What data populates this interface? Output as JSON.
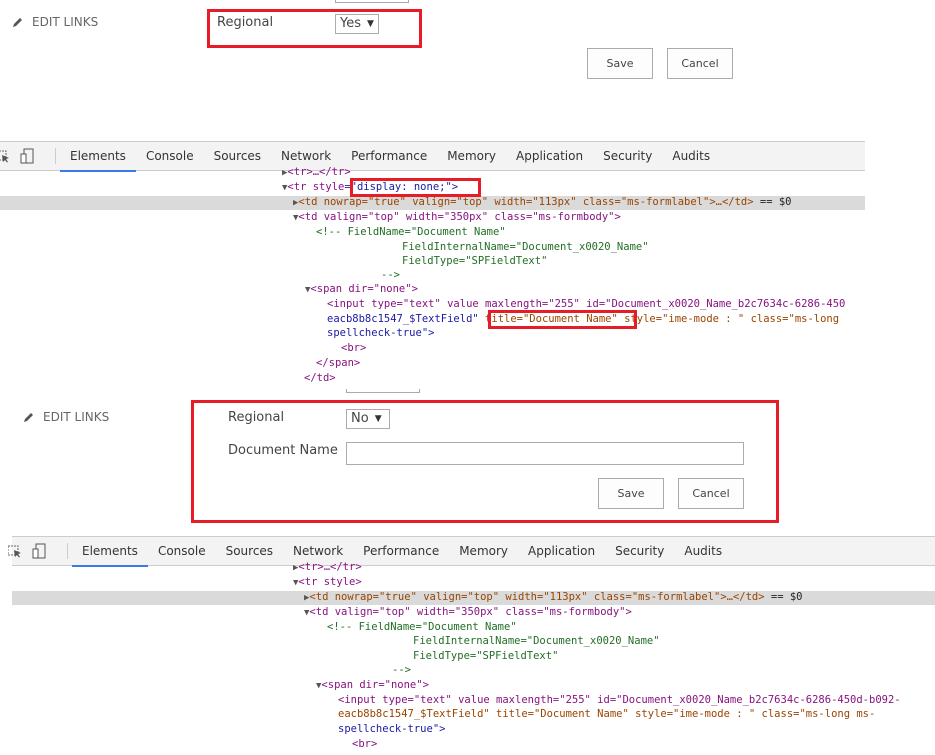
{
  "top_form": {
    "edit_links": "EDIT LINKS",
    "regional_label": "Regional",
    "regional_value": "Yes",
    "save_label": "Save",
    "cancel_label": "Cancel"
  },
  "devtools_tabs": [
    "Elements",
    "Console",
    "Sources",
    "Network",
    "Performance",
    "Memory",
    "Application",
    "Security",
    "Audits"
  ],
  "devtools_active_tab": "Elements",
  "top_code": {
    "l1": "<tr>…</tr>",
    "l2_tag": "<tr style",
    "l2_val": "=\"display: none;\">",
    "l3_a": "<td nowrap=\"true\" valign=\"top\" width=\"113px\" class=\"ms-formlabel\">…</td>",
    "l3_b": " == $0",
    "l4": "<td valign=\"top\" width=\"350px\" class=\"ms-formbody\">",
    "l5": "<!-- FieldName=\"Document Name\"",
    "l6": "FieldInternalName=\"Document_x0020_Name\"",
    "l7": "FieldType=\"SPFieldText\"",
    "l8": "-->",
    "l9": "<span dir=\"none\">",
    "l10": "<input type=\"text\" value maxlength=\"255\" id=\"Document_x0020_Name_b2c7634c-6286-450",
    "l11_a": "eacb8b8c1547_$TextField\" ",
    "l11_b": "title=\"Document Name\"",
    "l11_c": " style=\"ime-mode : \" class=\"ms-long",
    "l12": "spellcheck-true\">",
    "l13": "<br>",
    "l14": "</span>",
    "l15": "</td>"
  },
  "bottom_form": {
    "edit_links": "EDIT LINKS",
    "regional_label": "Regional",
    "regional_value": "No",
    "docname_label": "Document Name",
    "docname_value": "",
    "save_label": "Save",
    "cancel_label": "Cancel"
  },
  "bottom_code": {
    "l1": "<tr>…</tr>",
    "l2": "<tr style>",
    "l3_a": "<td nowrap=\"true\" valign=\"top\" width=\"113px\" class=\"ms-formlabel\">…</td>",
    "l3_b": " == $0",
    "l4": "<td valign=\"top\" width=\"350px\" class=\"ms-formbody\">",
    "l5": "<!-- FieldName=\"Document Name\"",
    "l6": "FieldInternalName=\"Document_x0020_Name\"",
    "l7": "FieldType=\"SPFieldText\"",
    "l8": "-->",
    "l9": "<span dir=\"none\">",
    "l10": "<input type=\"text\" value maxlength=\"255\" id=\"Document_x0020_Name_b2c7634c-6286-450d-b092-",
    "l11": "eacb8b8c1547_$TextField\" title=\"Document Name\" style=\"ime-mode : \" class=\"ms-long ms-",
    "l12": "spellcheck-true\">",
    "l13": "<br>"
  },
  "colors": {
    "highlight_border": "#e81c26",
    "devtools_active": "#3b7be8"
  }
}
